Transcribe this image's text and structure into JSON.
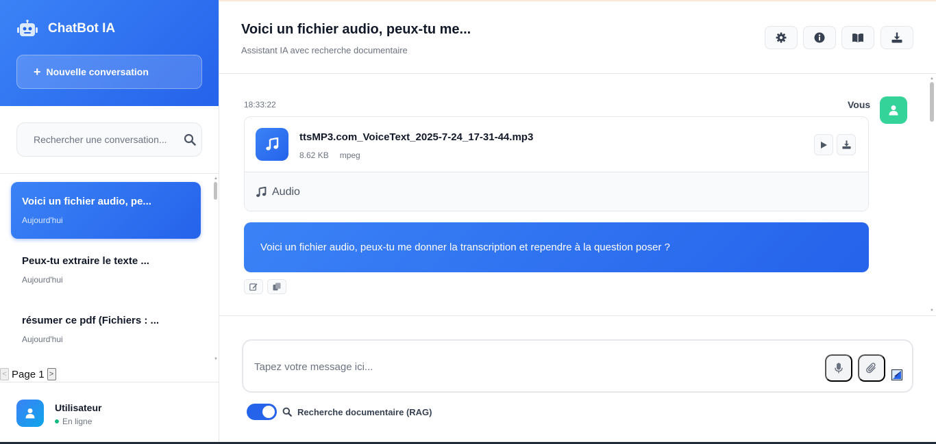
{
  "sidebar": {
    "brand_title": "ChatBot IA",
    "new_conversation_label": "Nouvelle conversation",
    "search_placeholder": "Rechercher une conversation...",
    "conversations": [
      {
        "title": "Voici un fichier audio, pe...",
        "date": "Aujourd'hui",
        "active": true
      },
      {
        "title": "Peux-tu extraire le texte ...",
        "date": "Aujourd'hui",
        "active": false
      },
      {
        "title": "résumer ce pdf (Fichiers : ...",
        "date": "Aujourd'hui",
        "active": false
      }
    ],
    "pager_label": "Page 1",
    "user": {
      "name": "Utilisateur",
      "status": "En ligne"
    }
  },
  "header": {
    "title": "Voici un fichier audio, peux-tu me...",
    "subtitle": "Assistant IA avec recherche documentaire",
    "buttons": [
      "gear-icon",
      "info-icon",
      "book-icon",
      "download-icon"
    ]
  },
  "message": {
    "time": "18:33:22",
    "author": "Vous",
    "file": {
      "name": "ttsMP3.com_VoiceText_2025-7-24_17-31-44.mp3",
      "size": "8.62 KB",
      "type": "mpeg",
      "preview_label": "Audio"
    },
    "text": "Voici un fichier audio, peux-tu me donner la transcription et rependre à la question poser ?"
  },
  "composer": {
    "placeholder": "Tapez votre message ici...",
    "rag_label": "Recherche documentaire (RAG)",
    "rag_enabled": true
  },
  "colors": {
    "accent": "#2563eb",
    "accent_light": "#3b82f6",
    "user_avatar": "#34d399",
    "online": "#10b981"
  }
}
